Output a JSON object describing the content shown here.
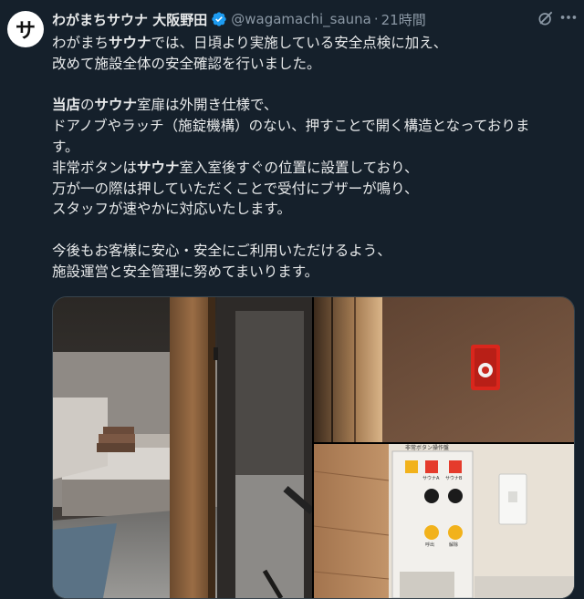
{
  "author": {
    "avatar_glyph": "サ",
    "name": "わがまちサウナ 大阪野田",
    "handle": "@wagamachi_sauna",
    "separator": "·",
    "time": "21時間"
  },
  "icons": {
    "verified": "verified-badge-icon",
    "grok": "grok-icon",
    "more": "more-icon"
  },
  "post": {
    "lines": [
      [
        "わがまち",
        "サウナ",
        "では、日頃より実施している安全点検に加え、"
      ],
      [
        "改めて施設全体の安全確認を行いました。"
      ],
      [
        ""
      ],
      [
        "当店",
        "の",
        "サウナ",
        "室扉は外開き仕様で、"
      ],
      [
        "ドアノブやラッチ（施錠機構）のない、押すことで開く構造となっておりま"
      ],
      [
        "す。"
      ],
      [
        "非常ボタンは",
        "サウナ",
        "室入室後すぐの位置に設置しており、"
      ],
      [
        "万が一の際は押していただくことで受付にブザーが鳴り、"
      ],
      [
        "スタッフが速やかに対応いたします。"
      ],
      [
        ""
      ],
      [
        "今後もお客様に安心・安全にご利用いただけるよう、"
      ],
      [
        "施設運営と安全管理に努めてまいります。"
      ]
    ],
    "bold_words": [
      "サウナ",
      "当店"
    ]
  },
  "panel": {
    "label": "非常ボタン操作盤",
    "lamp_labels": [
      "サウナA",
      "サウナB"
    ],
    "button_labels": [
      "呼出",
      "解除"
    ]
  },
  "colors": {
    "background": "#15202b",
    "text": "#e7e9ea",
    "muted": "#8b98a5",
    "verified": "#1d9bf0",
    "alarm_red": "#d9261c",
    "lamp_red": "#e53b2c",
    "lamp_yellow": "#f2b21b"
  }
}
